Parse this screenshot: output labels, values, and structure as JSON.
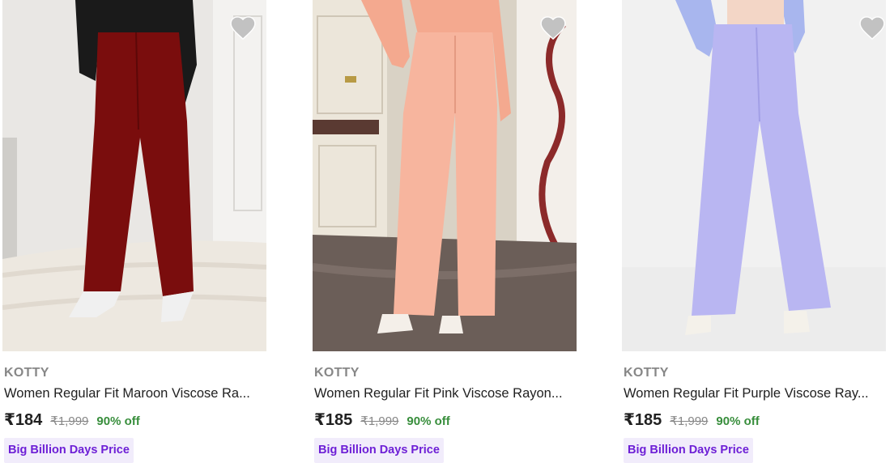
{
  "products": [
    {
      "brand": "KOTTY",
      "title": "Women Regular Fit Maroon Viscose Ra...",
      "price": "₹184",
      "mrp": "₹1,999",
      "discount": "90% off",
      "badge": "Big Billion Days Price",
      "image_icon": "maroon-trousers-photo",
      "product_color": "#7a0d0d"
    },
    {
      "brand": "KOTTY",
      "title": "Women Regular Fit Pink Viscose Rayon...",
      "price": "₹185",
      "mrp": "₹1,999",
      "discount": "90% off",
      "badge": "Big Billion Days Price",
      "image_icon": "pink-trousers-photo",
      "product_color": "#f7b59e"
    },
    {
      "brand": "KOTTY",
      "title": "Women Regular Fit Purple Viscose Ray...",
      "price": "₹185",
      "mrp": "₹1,999",
      "discount": "90% off",
      "badge": "Big Billion Days Price",
      "image_icon": "purple-trousers-photo",
      "product_color": "#b9b6f2"
    }
  ],
  "colors": {
    "discount": "#388e3c",
    "badge_text": "#6d1fd6",
    "badge_bg": "#f1ecfb",
    "muted": "#878787"
  },
  "icons": {
    "wishlist": "heart-icon"
  }
}
